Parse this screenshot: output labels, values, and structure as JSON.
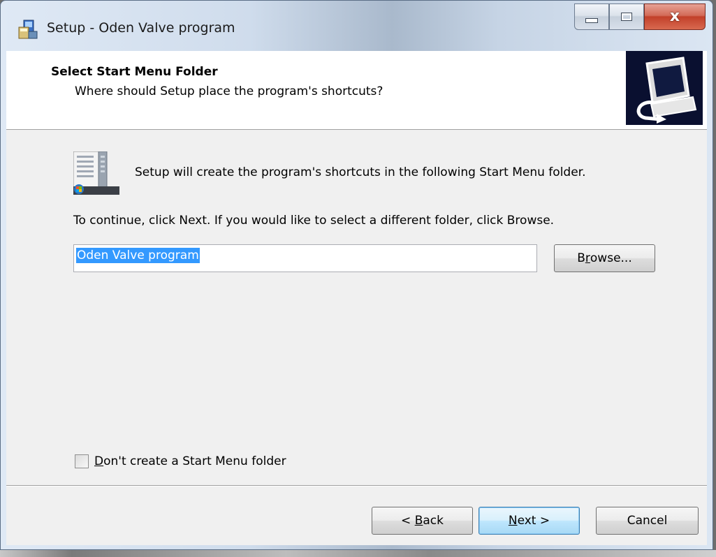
{
  "window": {
    "title": "Setup - Oden Valve program",
    "caption_buttons": {
      "minimize": "minimize-icon",
      "maximize": "maximize-icon",
      "close": "x"
    }
  },
  "header": {
    "title": "Select Start Menu Folder",
    "subtitle": "Where should Setup place the program's shortcuts?"
  },
  "body": {
    "intro": "Setup will create the program's shortcuts in the following Start Menu folder.",
    "instructions": "To continue, click Next. If you would like to select a different folder, click Browse.",
    "folder_value": "Oden Valve program",
    "browse_label": {
      "pre": "B",
      "ul": "r",
      "post": "owse..."
    },
    "dont_create": {
      "pre": "",
      "ul": "D",
      "post": "on't create a Start Menu folder",
      "checked": false
    }
  },
  "footer": {
    "back": {
      "pre": "< ",
      "ul": "B",
      "post": "ack"
    },
    "next": {
      "pre": "",
      "ul": "N",
      "post": "ext >"
    },
    "cancel": "Cancel"
  },
  "colors": {
    "selection": "#3399ff",
    "default_button": "#bee6fd",
    "close_button": "#c2402a"
  }
}
